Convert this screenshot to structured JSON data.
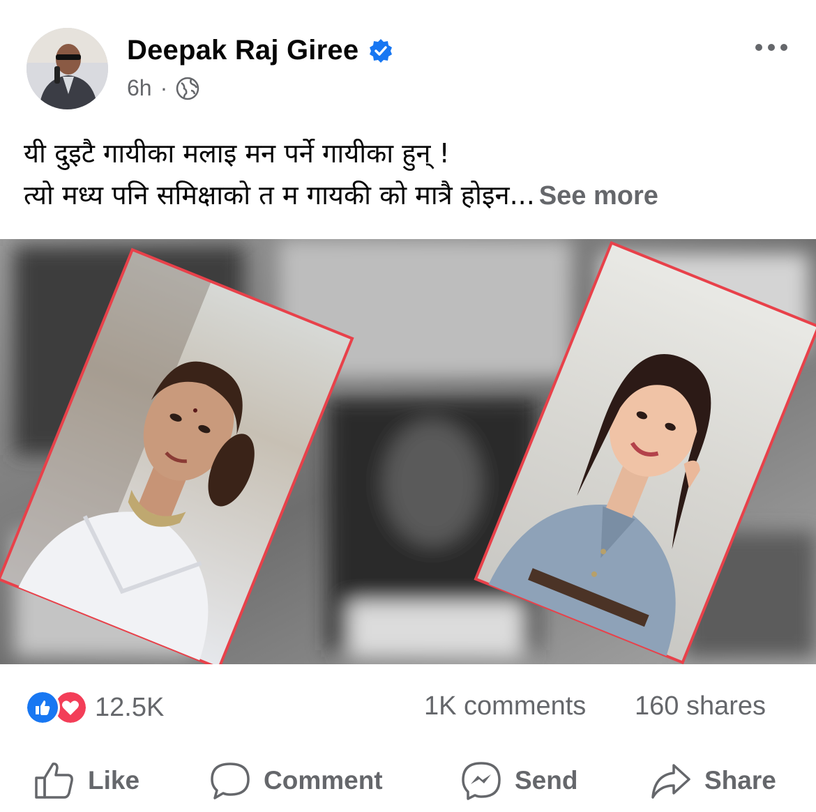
{
  "post": {
    "author": "Deepak Raj Giree",
    "time": "6h",
    "separator": "·",
    "caption_line1": "यी दुइटै गायीका मलाइ मन पर्ने गायीका हुन् !",
    "caption_line2": "त्यो मध्य पनि समिक्षाको त म गायकी को मात्रै होइन...",
    "see_more": "See more",
    "icons": {
      "verified": "verified-badge-icon",
      "audience": "globe-icon",
      "menu": "more-options-icon"
    }
  },
  "stats": {
    "reactions": "12.5K",
    "comments": "1K comments",
    "shares": "160 shares",
    "reaction_types": [
      "like",
      "love"
    ]
  },
  "actions": {
    "like": "Like",
    "comment": "Comment",
    "send": "Send",
    "share": "Share"
  },
  "colors": {
    "brand_blue": "#1877f2",
    "love_red": "#f33e58",
    "secondary_text": "#65676b",
    "frame_red": "#e8414a"
  }
}
